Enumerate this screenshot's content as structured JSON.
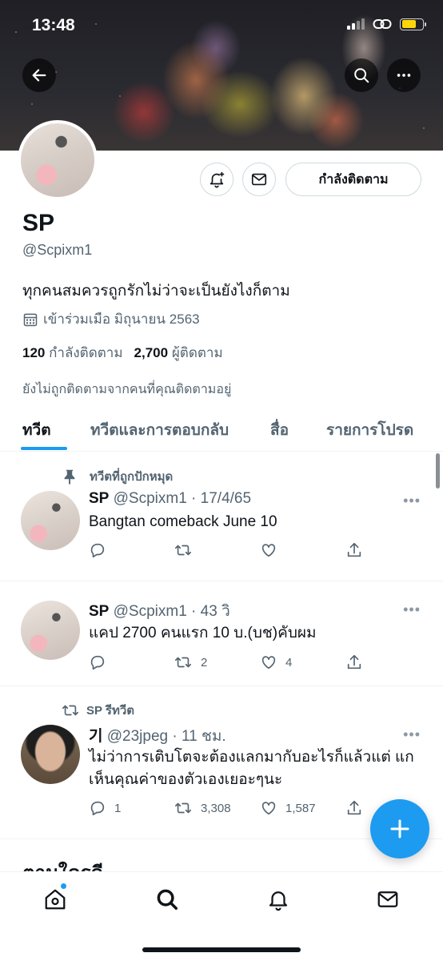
{
  "status_bar": {
    "time": "13:48"
  },
  "profile": {
    "name": "SP",
    "handle": "@Scpixm1",
    "bio": "ทุกคนสมควรถูกรักไม่ว่าจะเป็นยังไงก็ตาม",
    "joined": "เข้าร่วมเมือ มิถุนายน 2563",
    "following_count": "120",
    "following_label": "กำลังติดตาม",
    "followers_count": "2,700",
    "followers_label": "ผู้ติดตาม",
    "not_followed_text": "ยังไม่ถูกติดตามจากคนที่คุณติดตามอยู่",
    "following_button": "กำลังติดตาม"
  },
  "tabs": [
    {
      "label": "ทวีต"
    },
    {
      "label": "ทวีตและการตอบกลับ"
    },
    {
      "label": "สื่อ"
    },
    {
      "label": "รายการโปรด"
    }
  ],
  "tweets": [
    {
      "context": "ทวีตที่ถูกปักหมุด",
      "name": "SP",
      "meta": "@Scpixm1 · 17/4/65",
      "text": "Bangtan comeback June 10",
      "replies": "",
      "retweets": "",
      "likes": ""
    },
    {
      "name": "SP",
      "meta": "@Scpixm1 · 43 วิ",
      "text": "แคป 2700 คนแรก 10 บ.(บช)คับผม",
      "replies": "",
      "retweets": "2",
      "likes": "4"
    },
    {
      "context": "SP รีทวีต",
      "name": "기",
      "meta": "@23jpeg · 11 ชม.",
      "text": "ไม่ว่าการเติบโตจะต้องแลกมากับอะไรก็แล้วแต่ แกเห็นคุณค่าของตัวเองเยอะๆนะ",
      "replies": "1",
      "retweets": "3,308",
      "likes": "1,587"
    }
  ],
  "who_to_follow_title": "ตามใครดี",
  "colors": {
    "accent": "#1d9bf0",
    "secondary_text": "#536471",
    "border": "#cfd9de"
  },
  "icons": [
    "back-arrow-icon",
    "search-icon",
    "more-icon",
    "bell-plus-icon",
    "mail-icon",
    "calendar-icon",
    "pin-icon",
    "reply-icon",
    "retweet-icon",
    "like-icon",
    "share-icon",
    "compose-icon",
    "home-icon",
    "explore-icon",
    "notifications-icon",
    "messages-icon"
  ]
}
